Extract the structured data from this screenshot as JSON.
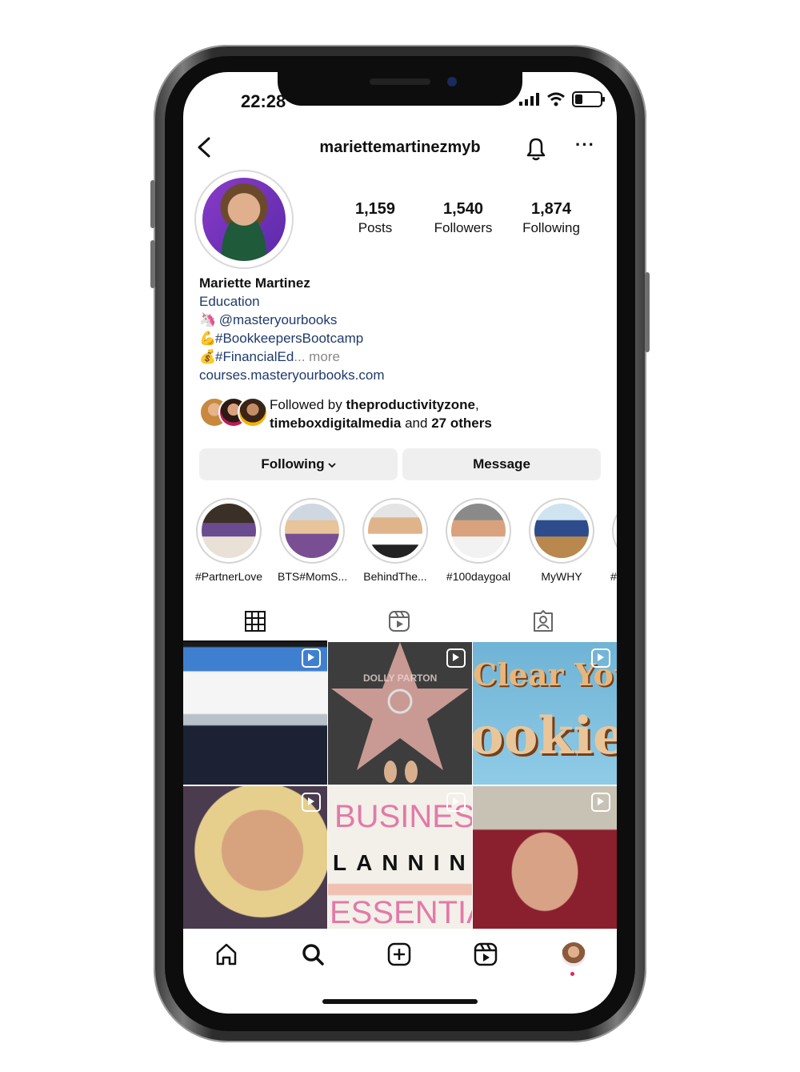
{
  "status_bar": {
    "time": "22:28"
  },
  "header": {
    "username": "mariettemartinezmyb",
    "more": "···"
  },
  "stats": [
    {
      "value": "1,159",
      "label": "Posts"
    },
    {
      "value": "1,540",
      "label": "Followers"
    },
    {
      "value": "1,874",
      "label": "Following"
    }
  ],
  "bio": {
    "name": "Mariette Martinez",
    "category": "Education",
    "line1_emoji": "🦄",
    "line1": "@masteryourbooks",
    "line2_emoji": "💪",
    "line2": "#BookkeepersBootcamp",
    "line3_emoji": "💰",
    "line3": "#FinancialEd",
    "line3_more": "... more",
    "link": "courses.masteryourbooks.com"
  },
  "followed_by": {
    "prefix": "Followed by ",
    "user1": "theproductivityzone",
    "sep": ",",
    "user2": "timeboxdigitalmedia",
    "mid": " and ",
    "others": "27 others"
  },
  "buttons": {
    "following": "Following",
    "following_chevron": "⌄",
    "message": "Message"
  },
  "highlights": [
    {
      "label": "#PartnerLove"
    },
    {
      "label": "BTS#MomS..."
    },
    {
      "label": "BehindThe..."
    },
    {
      "label": "#100daygoal"
    },
    {
      "label": "MyWHY"
    },
    {
      "label": "#w"
    }
  ],
  "grid_text": {
    "cookie_top": "Clear Your",
    "cookie_bottom": "ookie",
    "biz_top": "BUSINESS",
    "biz_mid": "LANNIN",
    "biz_bottom": "ESSENTIAL",
    "star_name": "DOLLY PARTON"
  }
}
